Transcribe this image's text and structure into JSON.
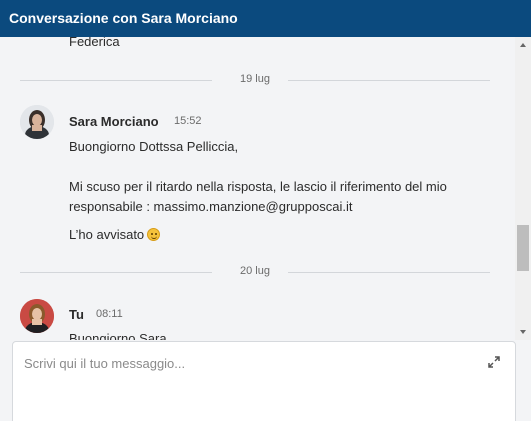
{
  "header": {
    "title": "Conversazione con Sara Morciano"
  },
  "messages_top": {
    "partial_text": "Federica"
  },
  "separators": [
    {
      "label": "19 lug"
    },
    {
      "label": "20 lug"
    }
  ],
  "message_sara": {
    "sender": "Sara Morciano",
    "time": "15:52",
    "line1": "Buongiorno Dottssa Pelliccia,",
    "line2": "Mi scuso per il ritardo nella risposta, le lascio il riferimento del mio",
    "line3": "responsabile : massimo.manzione@grupposcai.it",
    "line4": "L’ho avvisato",
    "emoji_icon": "smiling-face-emoji"
  },
  "message_tu": {
    "sender": "Tu",
    "time": "08:11",
    "line1": "Buongiorno Sara"
  },
  "composer": {
    "placeholder": "Scrivi qui il tuo messaggio...",
    "expand_icon": "expand-icon"
  }
}
